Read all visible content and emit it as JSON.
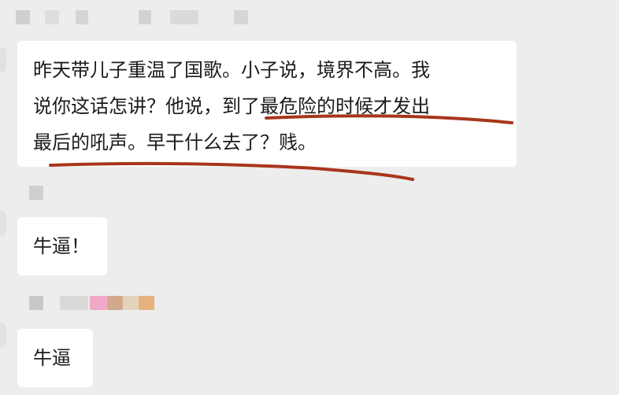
{
  "messages": [
    {
      "lines": [
        "昨天带儿子重温了国歌。小子说，境界不高。我",
        "说你这话怎讲？他说，到了最危险的时候才发出",
        "最后的吼声。早干什么去了？贱。"
      ]
    },
    {
      "lines": [
        "牛逼！"
      ]
    },
    {
      "lines": [
        "牛逼"
      ]
    }
  ],
  "colors": {
    "background": "#ededed",
    "bubble": "#ffffff",
    "text": "#1b1b1b",
    "underline": "#a8361c"
  }
}
